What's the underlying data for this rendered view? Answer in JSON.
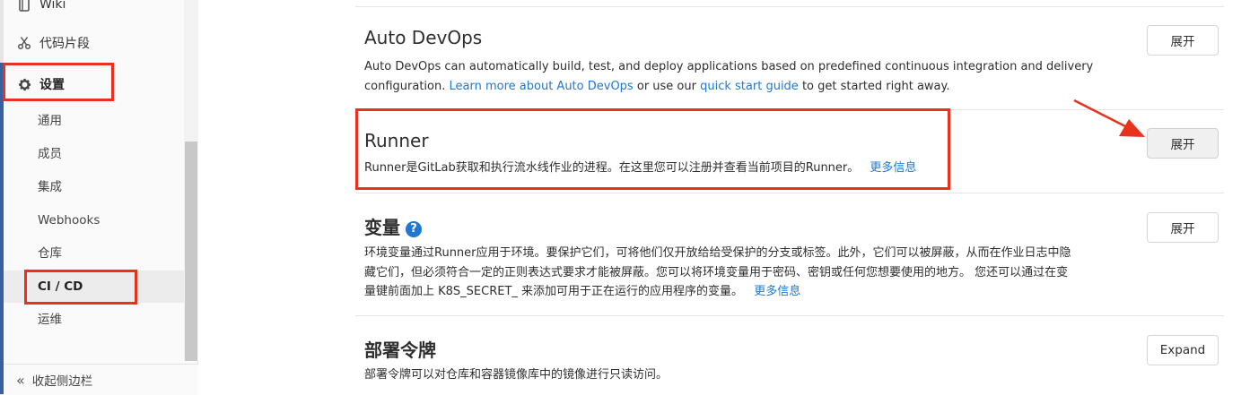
{
  "sidebar": {
    "items": [
      {
        "label": "Wiki",
        "icon": "wiki-icon"
      },
      {
        "label": "代码片段",
        "icon": "scissors-icon"
      },
      {
        "label": "设置",
        "icon": "gear-icon"
      }
    ],
    "sub_items": [
      "通用",
      "成员",
      "集成",
      "Webhooks",
      "仓库",
      "CI / CD",
      "运维"
    ],
    "active_sub_item": "CI / CD",
    "collapse_label": "收起侧边栏",
    "collapse_icon": "double-chevron-left-icon"
  },
  "sections": {
    "auto_devops": {
      "title": "Auto DevOps",
      "desc_line1": "Auto DevOps can automatically build, test, and deploy applications based on predefined continuous integration and delivery",
      "desc_line2_prefix": "configuration.",
      "learn_more_link": "Learn more about Auto DevOps",
      "desc_mid": "or use our",
      "quick_start_link": "quick start guide",
      "desc_suffix": "to get started right away.",
      "button": "展开"
    },
    "runner": {
      "title": "Runner",
      "desc": "Runner是GitLab获取和执行流水线作业的进程。在这里您可以注册并查看当前项目的Runner。",
      "more_link": "更多信息",
      "button": "展开"
    },
    "variables": {
      "title": "变量",
      "help_icon": "question-circle-icon",
      "desc_line1": "环境变量通过Runner应用于环境。要保护它们，可将他们仅开放给给受保护的分支或标签。此外，它们可以被屏蔽，从而在作业日志中隐",
      "desc_line2": "藏它们，但必须符合一定的正则表达式要求才能被屏蔽。您可以将环境变量用于密码、密钥或任何您想要使用的地方。 您还可以通过在变",
      "desc_line3": "量键前面加上 K8S_SECRET_ 来添加可用于正在运行的应用程序的变量。",
      "more_link": "更多信息",
      "button": "展开"
    },
    "deploy_tokens": {
      "title": "部署令牌",
      "desc": "部署令牌可以对仓库和容器镜像库中的镜像进行只读访问。",
      "button": "Expand"
    }
  },
  "annotations": {
    "color": "#e8321e",
    "arrow_target": "runner-expand-button"
  },
  "colors": {
    "link": "#1f78d1",
    "sidebar_accent": "#3a5f9e"
  }
}
